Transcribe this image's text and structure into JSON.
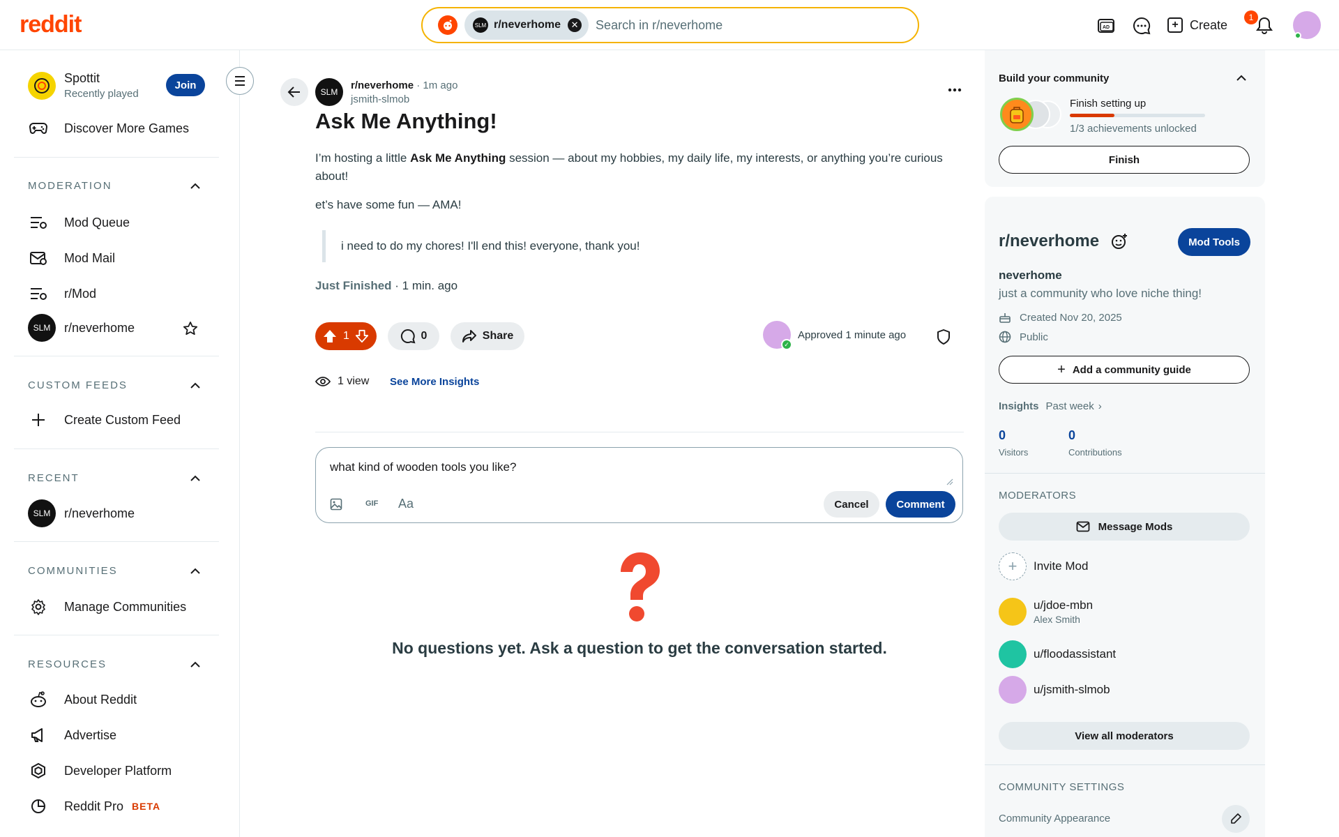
{
  "header": {
    "logo": "reddit",
    "search_chip": "r/neverhome",
    "search_placeholder": "Search in r/neverhome",
    "create_label": "Create",
    "notif_count": "1",
    "icons": [
      "ads-icon",
      "chat-icon",
      "create-icon",
      "bell-icon",
      "avatar"
    ]
  },
  "sidebar": {
    "game": {
      "name": "Spottit",
      "sub": "Recently played",
      "join": "Join"
    },
    "discover": "Discover More Games",
    "moderation": {
      "title": "MODERATION",
      "items": [
        "Mod Queue",
        "Mod Mail",
        "r/Mod",
        "r/neverhome"
      ]
    },
    "custom_feeds": {
      "title": "CUSTOM FEEDS",
      "items": [
        "Create Custom Feed"
      ]
    },
    "recent": {
      "title": "RECENT",
      "items": [
        "r/neverhome"
      ]
    },
    "communities": {
      "title": "COMMUNITIES",
      "items": [
        "Manage Communities"
      ]
    },
    "resources": {
      "title": "RESOURCES",
      "items": [
        "About Reddit",
        "Advertise",
        "Developer Platform",
        "Reddit Pro"
      ],
      "beta": "BETA"
    }
  },
  "post": {
    "sub": "r/neverhome",
    "time": "· 1m ago",
    "author": "jsmith-slmob",
    "avatar_text": "SLM",
    "title": "Ask Me Anything!",
    "body_pre": "I’m hosting a little ",
    "body_bold": "Ask Me Anything",
    "body_post": " session — about my hobbies, my daily life, my interests, or anything you’re curious about!",
    "line2": "et’s have some fun — AMA!",
    "quote": "i need to do my chores! I'll end this! everyone, thank you!",
    "status_tag": "Just Finished",
    "status_time": " · 1 min. ago",
    "votes": "1",
    "comments": "0",
    "share": "Share",
    "approved": "Approved 1 minute ago",
    "views": "1 view",
    "insights": "See More Insights"
  },
  "composer": {
    "text": "what kind of wooden tools you like?",
    "gif": "GIF",
    "format": "Aa",
    "cancel": "Cancel",
    "comment": "Comment"
  },
  "empty": {
    "message": "No questions yet. Ask a question to get the conversation started."
  },
  "right": {
    "build": {
      "title": "Build your community",
      "progress_label": "Finish setting up",
      "achievements": "1/3 achievements unlocked",
      "progress_fraction": 0.33,
      "finish": "Finish"
    },
    "community": {
      "name": "r/neverhome",
      "mod_tools": "Mod Tools",
      "display_name": "neverhome",
      "description": "just a community who love niche thing!",
      "created": "Created Nov 20, 2025",
      "visibility": "Public",
      "add_guide": "Add a community guide",
      "insights_label": "Insights",
      "insights_period": "Past week",
      "visitors": "0",
      "visitors_label": "Visitors",
      "contributions": "0",
      "contributions_label": "Contributions"
    },
    "moderators": {
      "title": "MODERATORS",
      "message": "Message Mods",
      "invite": "Invite Mod",
      "list": [
        {
          "name": "u/jdoe-mbn",
          "sub": "Alex Smith",
          "color": "#f5c518"
        },
        {
          "name": "u/floodassistant",
          "sub": "",
          "color": "#1fc4a2"
        },
        {
          "name": "u/jsmith-slmob",
          "sub": "",
          "color": "#d6a9e8"
        }
      ],
      "view_all": "View all moderators"
    },
    "settings": {
      "title": "COMMUNITY SETTINGS",
      "appearance": "Community Appearance"
    }
  },
  "colors": {
    "brand": "#ff4500",
    "accent_blue": "#0a449b",
    "upvote_bg": "#d93a00"
  }
}
